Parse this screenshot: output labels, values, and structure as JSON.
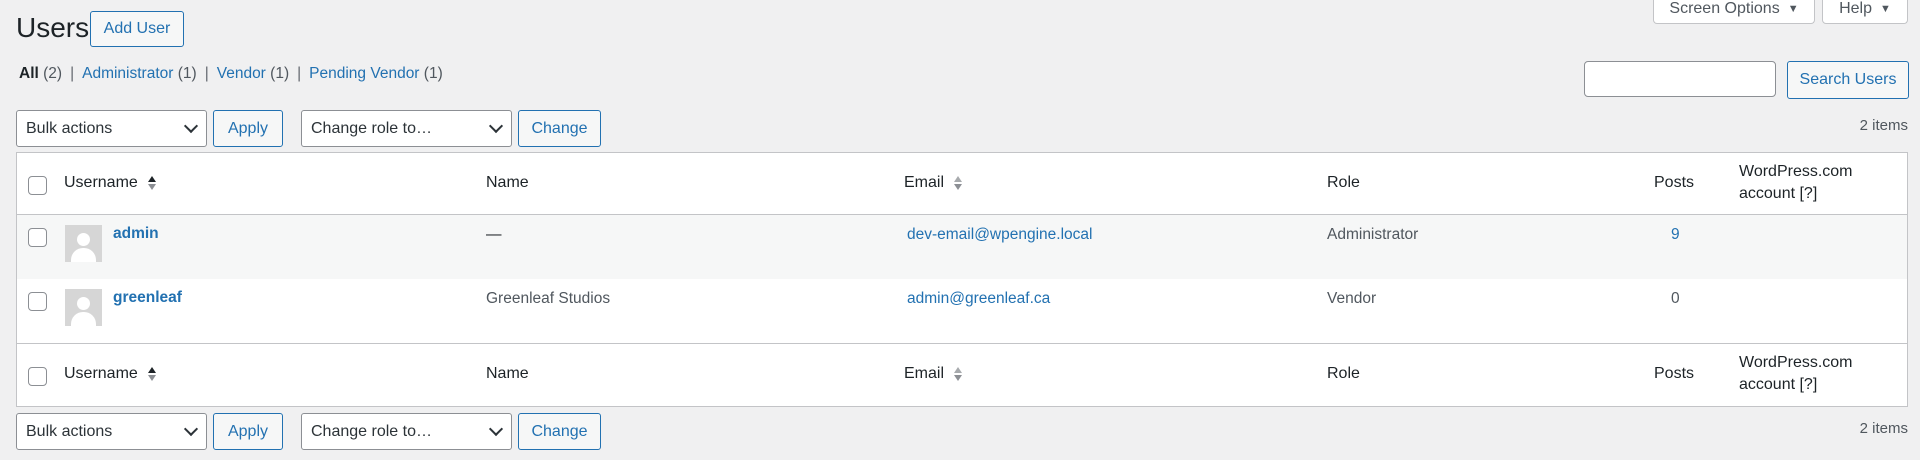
{
  "page": {
    "title": "Users",
    "add_user": "Add User"
  },
  "topbar": {
    "screen_options": "Screen Options",
    "help": "Help"
  },
  "filters": {
    "all": {
      "label": "All",
      "count": "(2)"
    },
    "administrator": {
      "label": "Administrator",
      "count": "(1)"
    },
    "vendor": {
      "label": "Vendor",
      "count": "(1)"
    },
    "pending_vendor": {
      "label": "Pending Vendor",
      "count": "(1)"
    },
    "separator": "|"
  },
  "search": {
    "value": "",
    "button": "Search Users"
  },
  "tablenav": {
    "bulk_actions": "Bulk actions",
    "apply": "Apply",
    "change_role": "Change role to…",
    "change": "Change",
    "items": "2 items"
  },
  "columns": {
    "username": "Username",
    "name": "Name",
    "email": "Email",
    "role": "Role",
    "posts": "Posts",
    "wpcom_line1": "WordPress.com",
    "wpcom_line2": "account  [?]"
  },
  "users": [
    {
      "username": "admin",
      "name": "—",
      "email": "dev-email@wpengine.local",
      "role": "Administrator",
      "posts": "9"
    },
    {
      "username": "greenleaf",
      "name": "Greenleaf Studios",
      "email": "admin@greenleaf.ca",
      "role": "Vendor",
      "posts": "0"
    }
  ],
  "colors": {
    "link": "#2271b1",
    "background": "#f0f0f1",
    "text": "#1d2327"
  },
  "icons": {
    "sort": "sort-arrows-icon",
    "avatar": "default-avatar-icon",
    "dropdown": "chevron-down-icon"
  }
}
